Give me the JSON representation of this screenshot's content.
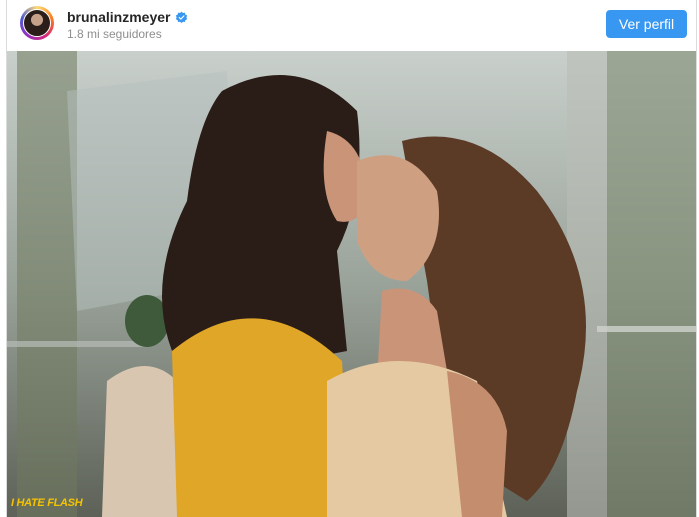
{
  "post": {
    "username": "brunalinzmeyer",
    "followers": "1.8 mi seguidores",
    "view_profile_label": "Ver perfil",
    "verified_color": "#3897f0",
    "button_color": "#3897f0"
  },
  "photo": {
    "watermark": "I HATE FLASH"
  }
}
